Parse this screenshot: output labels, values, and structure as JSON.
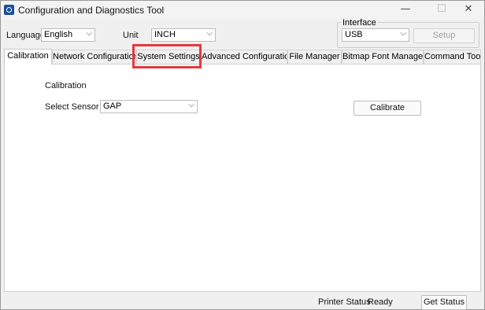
{
  "window": {
    "title": "Configuration and Diagnostics Tool",
    "controls": {
      "minimize": "—",
      "maximize": "☐",
      "close": "✕"
    }
  },
  "toolbar": {
    "language_label": "Language",
    "language_value": "English",
    "unit_label": "Unit",
    "unit_value": "INCH",
    "interface_label": "Interface",
    "interface_value": "USB",
    "setup_button": "Setup"
  },
  "tabs": [
    {
      "label": "Calibration",
      "active": true
    },
    {
      "label": "Network Configuration",
      "active": false
    },
    {
      "label": "System Settings",
      "active": false
    },
    {
      "label": "Advanced Configuration",
      "active": false
    },
    {
      "label": "File Manager",
      "active": false
    },
    {
      "label": "Bitmap Font Manager",
      "active": false
    },
    {
      "label": "Command Tool",
      "active": false
    }
  ],
  "calibration_panel": {
    "heading": "Calibration",
    "sensor_label": "Select Sensor",
    "sensor_value": "GAP",
    "calibrate_button": "Calibrate"
  },
  "status_bar": {
    "printer_status_label": "Printer Status",
    "printer_status_value": "Ready",
    "get_status_button": "Get Status"
  },
  "icons": {
    "chevron": "⌵",
    "app_icon": "app-icon"
  },
  "colors": {
    "highlight": "#e5393b",
    "window_bg": "#f0f0f0",
    "panel_bg": "#ffffff"
  }
}
